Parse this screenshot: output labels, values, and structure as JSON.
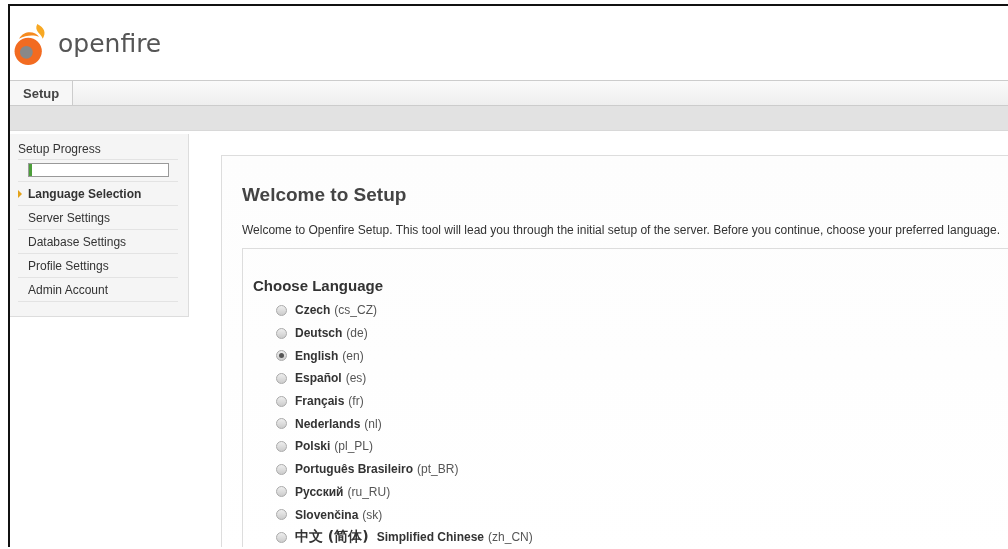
{
  "header": {
    "logo_text": "openfire"
  },
  "tabs": [
    {
      "label": "Setup",
      "selected": true
    }
  ],
  "sidebar": {
    "title": "Setup Progress",
    "progress": {
      "level": 0.02
    },
    "items": [
      {
        "label": "Language Selection",
        "selected": true
      },
      {
        "label": "Server Settings",
        "selected": false
      },
      {
        "label": "Database Settings",
        "selected": false
      },
      {
        "label": "Profile Settings",
        "selected": false
      },
      {
        "label": "Admin Account",
        "selected": false
      }
    ]
  },
  "main": {
    "title": "Welcome to Setup",
    "intro": "Welcome to Openfire Setup. This tool will lead you through the initial setup of the server. Before you continue, choose your preferred language.",
    "section_title": "Choose Language",
    "languages": [
      {
        "name": "Czech",
        "code": "(cs_CZ)",
        "selected": false
      },
      {
        "name": "Deutsch",
        "code": "(de)",
        "selected": false
      },
      {
        "name": "English",
        "code": "(en)",
        "selected": true
      },
      {
        "name": "Español",
        "code": "(es)",
        "selected": false
      },
      {
        "name": "Français",
        "code": "(fr)",
        "selected": false
      },
      {
        "name": "Nederlands",
        "code": "(nl)",
        "selected": false
      },
      {
        "name": "Polski",
        "code": "(pl_PL)",
        "selected": false
      },
      {
        "name": "Português Brasileiro",
        "code": "(pt_BR)",
        "selected": false
      },
      {
        "name": "Русский",
        "code": "(ru_RU)",
        "selected": false
      },
      {
        "name": "Slovenčina",
        "code": "(sk)",
        "selected": false
      },
      {
        "native": "中文 (简体)",
        "name": "Simplified Chinese",
        "code": "(zh_CN)",
        "selected": false
      }
    ]
  }
}
